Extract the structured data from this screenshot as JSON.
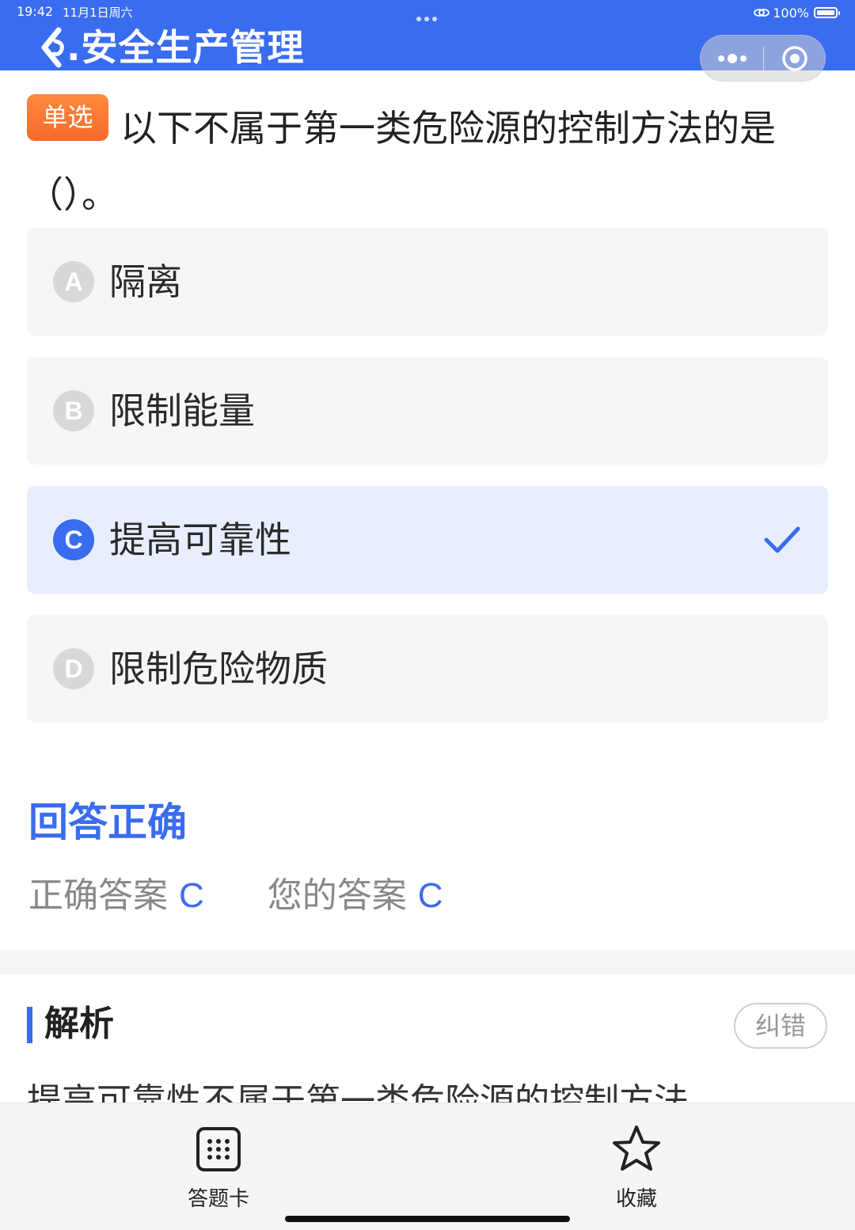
{
  "status_bar": {
    "time": "19:42",
    "date": "11月1日周六",
    "battery": "100%"
  },
  "header": {
    "title": ".安全生产管理",
    "background_color": "#3a6cf0"
  },
  "question": {
    "type_badge": "单选",
    "text": "以下不属于第一类危险源的控制方法的是（）。"
  },
  "options": [
    {
      "letter": "A",
      "text": "隔离",
      "selected": false
    },
    {
      "letter": "B",
      "text": "限制能量",
      "selected": false
    },
    {
      "letter": "C",
      "text": "提高可靠性",
      "selected": true
    },
    {
      "letter": "D",
      "text": "限制危险物质",
      "selected": false
    }
  ],
  "result": {
    "title": "回答正确",
    "correct_label": "正确答案",
    "correct_value": "C",
    "your_label": "您的答案",
    "your_value": "C"
  },
  "analysis": {
    "title": "解析",
    "correction_button": "纠错",
    "text": "提高可靠性不属于第一类危险源的控制方法"
  },
  "bottom_bar": {
    "answer_card_label": "答题卡",
    "favorite_label": "收藏"
  },
  "icons": {
    "back": "back-arrow-icon",
    "more": "more-dots-icon",
    "close": "close-miniprogram-icon",
    "check": "checkmark-icon",
    "answer_card": "grid-icon",
    "favorite": "star-icon"
  },
  "colors": {
    "accent": "#3a6cf0",
    "badge": "#f46a2a",
    "selected_bg": "#e8eefd",
    "option_bg": "#f5f6f8"
  }
}
